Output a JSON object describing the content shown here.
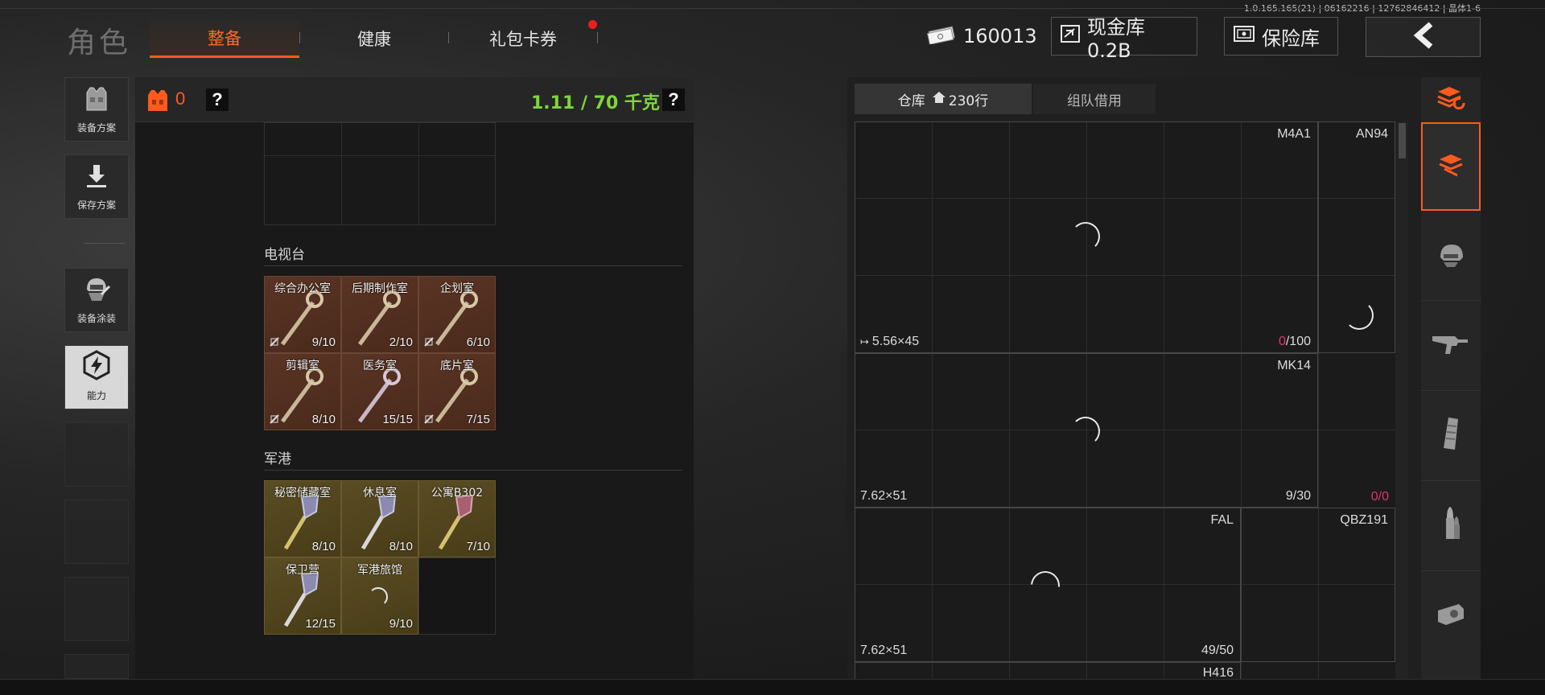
{
  "build_info": "1.0.165.165(21) | 06162216 | 12762846412 | 晶体1-6",
  "header": {
    "title": "角色",
    "tabs": [
      {
        "label": "整备",
        "active": true
      },
      {
        "label": "健康",
        "active": false
      },
      {
        "label": "礼包卡券",
        "active": false,
        "notification": true
      }
    ],
    "currency": {
      "value": "160013",
      "icon": "cash-icon"
    },
    "cash_vault": {
      "label": "现金库 0.2B",
      "icon": "vault-icon"
    },
    "safe": {
      "label": "保险库",
      "icon": "safe-icon"
    },
    "back_icon": "back-arrow-icon",
    "accent_color": "#ff5a1e"
  },
  "left_menu": [
    {
      "label": "装备方案",
      "icon": "vest-icon"
    },
    {
      "label": "保存方案",
      "icon": "download-icon"
    },
    {
      "label": "装备涂装",
      "icon": "helmet-paint-icon"
    },
    {
      "label": "能力",
      "icon": "ability-icon",
      "active": true
    }
  ],
  "equipment": {
    "armor_count": "0",
    "help": "?",
    "weight": "1.11 / 70 千克",
    "weight_color": "#7fd63a",
    "sections": [
      {
        "title": "电视台",
        "keys": [
          {
            "name": "综合办公室",
            "count": "9/10"
          },
          {
            "name": "后期制作室",
            "count": "2/10"
          },
          {
            "name": "企划室",
            "count": "6/10"
          },
          {
            "name": "剪辑室",
            "count": "8/10"
          },
          {
            "name": "医务室",
            "count": "15/15"
          },
          {
            "name": "底片室",
            "count": "7/15"
          }
        ]
      },
      {
        "title": "军港",
        "keys": [
          {
            "name": "秘密储藏室",
            "count": "8/10"
          },
          {
            "name": "休息室",
            "count": "8/10"
          },
          {
            "name": "公寓B302",
            "count": "7/10"
          },
          {
            "name": "保卫营",
            "count": "12/15"
          },
          {
            "name": "军港旅馆",
            "count": "9/10"
          }
        ]
      }
    ]
  },
  "warehouse": {
    "tabs": [
      {
        "label": "仓库",
        "suffix": "230行",
        "icon": "home-icon",
        "active": true
      },
      {
        "label": "组队借用",
        "active": false
      }
    ],
    "items": [
      {
        "name": "M4A1",
        "caliber": "5.56×45",
        "ammo_current": "0",
        "ammo_max": "/100"
      },
      {
        "name": "AN94"
      },
      {
        "name": "MK14",
        "caliber": "7.62×51",
        "ammo": "9/30",
        "extra_current": "0",
        "extra_max": "/0"
      },
      {
        "name": "FAL",
        "caliber": "7.62×51",
        "ammo": "49/50"
      },
      {
        "name": "QBZ191"
      },
      {
        "name": "H416"
      }
    ],
    "categories": [
      {
        "icon": "all-items-icon"
      },
      {
        "icon": "stack-icon",
        "active": true
      },
      {
        "icon": "helmet-icon"
      },
      {
        "icon": "rifle-icon"
      },
      {
        "icon": "magazine-icon"
      },
      {
        "icon": "bullet-icon"
      },
      {
        "icon": "scope-icon"
      }
    ]
  }
}
